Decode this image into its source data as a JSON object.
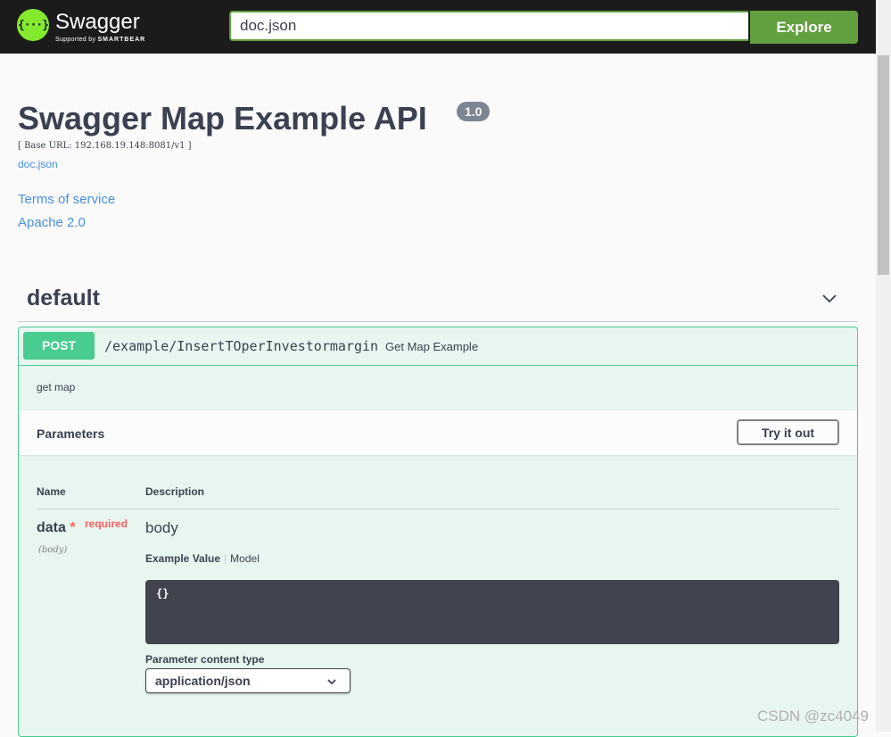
{
  "header": {
    "brand": "Swagger",
    "brand_sub_prefix": "Supported by",
    "brand_sub_name": "SMARTBEAR",
    "logo_glyph": "{···}",
    "search_value": "doc.json",
    "explore_label": "Explore"
  },
  "info": {
    "title": "Swagger Map Example API",
    "version": "1.0",
    "base_url": "[ Base URL: 192.168.19.148:8081/v1 ]",
    "doc_link": "doc.json",
    "terms": "Terms of service",
    "license": "Apache 2.0"
  },
  "tag": {
    "name": "default",
    "chevron_icon": "chevron-down-icon"
  },
  "operation": {
    "method": "POST",
    "path": "/example/InsertTOperInvestormargin",
    "summary": "Get Map Example",
    "description": "get map",
    "parameters_title": "Parameters",
    "try_label": "Try it out",
    "col_name": "Name",
    "col_description": "Description",
    "param": {
      "name": "data",
      "star": "*",
      "required": "required",
      "in": "(body)",
      "description": "body",
      "tab_example": "Example Value",
      "tab_model": "Model",
      "example_code": "{}",
      "content_type_label": "Parameter content type",
      "content_type_value": "application/json"
    }
  },
  "colors": {
    "topbar": "#1b1b1b",
    "accent_green": "#62a03f",
    "post_green": "#49cc90",
    "link_blue": "#4990e2",
    "required_red": "#ff6060"
  },
  "watermark": "CSDN @zc4049"
}
